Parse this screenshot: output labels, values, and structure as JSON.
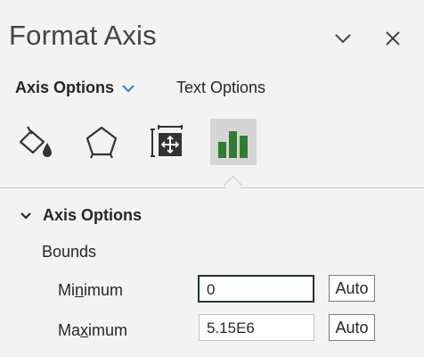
{
  "panel": {
    "title": "Format Axis",
    "collapse_icon": "chevron-down-icon",
    "close_icon": "close-icon"
  },
  "tabs": {
    "axis_options": "Axis Options",
    "text_options": "Text Options"
  },
  "icon_tabs": [
    {
      "name": "fill-line-icon",
      "selected": false
    },
    {
      "name": "effects-icon",
      "selected": false
    },
    {
      "name": "size-properties-icon",
      "selected": false
    },
    {
      "name": "axis-options-icon",
      "selected": true
    }
  ],
  "section": {
    "title": "Axis Options",
    "expanded": true
  },
  "bounds": {
    "label": "Bounds",
    "minimum": {
      "label_pre": "Mi",
      "label_key": "n",
      "label_post": "imum",
      "value": "0",
      "auto_label": "Auto"
    },
    "maximum": {
      "label_pre": "Ma",
      "label_key": "x",
      "label_post": "imum",
      "value": "5.15E6",
      "auto_label": "Auto"
    }
  },
  "colors": {
    "accent_blue": "#2b7cd3",
    "chart_green": "#2e7d32",
    "focus_border": "#1f3b24"
  }
}
